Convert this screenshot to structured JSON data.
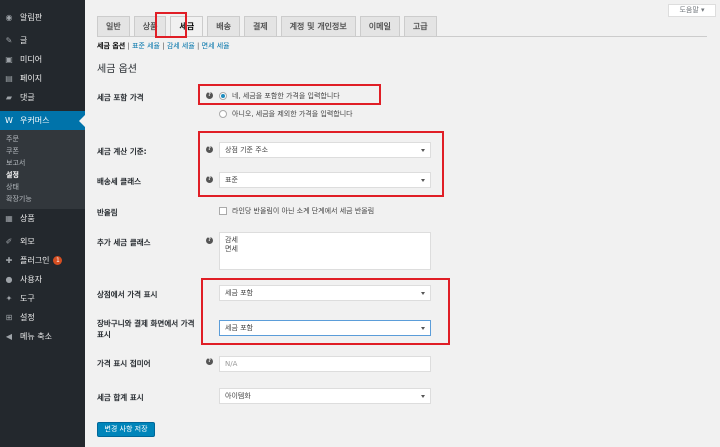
{
  "sidebar": {
    "items": [
      {
        "icon": "dashboard-icon",
        "glyph": "◉",
        "label": "알림판"
      },
      {
        "icon": "pin-icon",
        "glyph": "✎",
        "label": "글"
      },
      {
        "icon": "media-icon",
        "glyph": "▣",
        "label": "미디어"
      },
      {
        "icon": "page-icon",
        "glyph": "▤",
        "label": "페이지"
      },
      {
        "icon": "comment-icon",
        "glyph": "▰",
        "label": "댓글"
      },
      {
        "icon": "woo-icon",
        "glyph": "W",
        "label": "우커머스"
      }
    ],
    "sub_items": [
      "주문",
      "쿠폰",
      "보고서",
      "설정",
      "상태",
      "확장기능"
    ],
    "lower_items": [
      {
        "icon": "product-icon",
        "glyph": "▦",
        "label": "상품"
      },
      {
        "icon": "appearance-icon",
        "glyph": "✐",
        "label": "외모"
      },
      {
        "icon": "plugin-icon",
        "glyph": "✚",
        "label": "플러그인",
        "badge": "1"
      },
      {
        "icon": "user-icon",
        "glyph": "●",
        "label": "사용자"
      },
      {
        "icon": "tools-icon",
        "glyph": "✦",
        "label": "도구"
      },
      {
        "icon": "settings-icon",
        "glyph": "⊞",
        "label": "설정"
      },
      {
        "icon": "collapse-icon",
        "glyph": "◀",
        "label": "메뉴 축소"
      }
    ]
  },
  "header": {
    "help_label": "도움말 ▾"
  },
  "tabs": [
    "일반",
    "상품",
    "세금",
    "배송",
    "결제",
    "계정 및 개인정보",
    "이메일",
    "고급"
  ],
  "subnav": {
    "current": "세금 옵션",
    "links": [
      "표준 세율",
      "감세 세율",
      "면세 세율"
    ]
  },
  "section_title": "세금 옵션",
  "fields": {
    "prices_incl_tax": {
      "label": "세금 포함 가격",
      "options": [
        "네, 세금을 포함한 가격을 입력합니다",
        "아니오, 세금을 제외한 가격을 입력합니다"
      ]
    },
    "tax_based_on": {
      "label": "세금 계산 기준:",
      "value": "상점 기준 주소"
    },
    "shipping_tax_class": {
      "label": "배송세 클래스",
      "value": "표준"
    },
    "rounding": {
      "label": "반올림",
      "checkbox_label": "라인당 반올림이 아닌 소계 단계에서 세금 반올림"
    },
    "additional_tax_classes": {
      "label": "추가 세금 클래스",
      "lines": [
        "감세",
        "면세"
      ]
    },
    "display_shop": {
      "label": "상점에서 가격 표시",
      "value": "세금 포함"
    },
    "display_cart": {
      "label_line1": "장바구니와 결제 화면에서 가격",
      "label_line2": "표시",
      "value": "세금 포함"
    },
    "price_suffix": {
      "label": "가격 표시 접미어",
      "placeholder": "N/A"
    },
    "tax_total_display": {
      "label": "세금 합계 표시",
      "value": "아이템화"
    }
  },
  "save_button": "변경 사항 저장",
  "colors": {
    "highlight": "#e01e26",
    "accent": "#0073aa",
    "sidebar": "#23282d"
  }
}
